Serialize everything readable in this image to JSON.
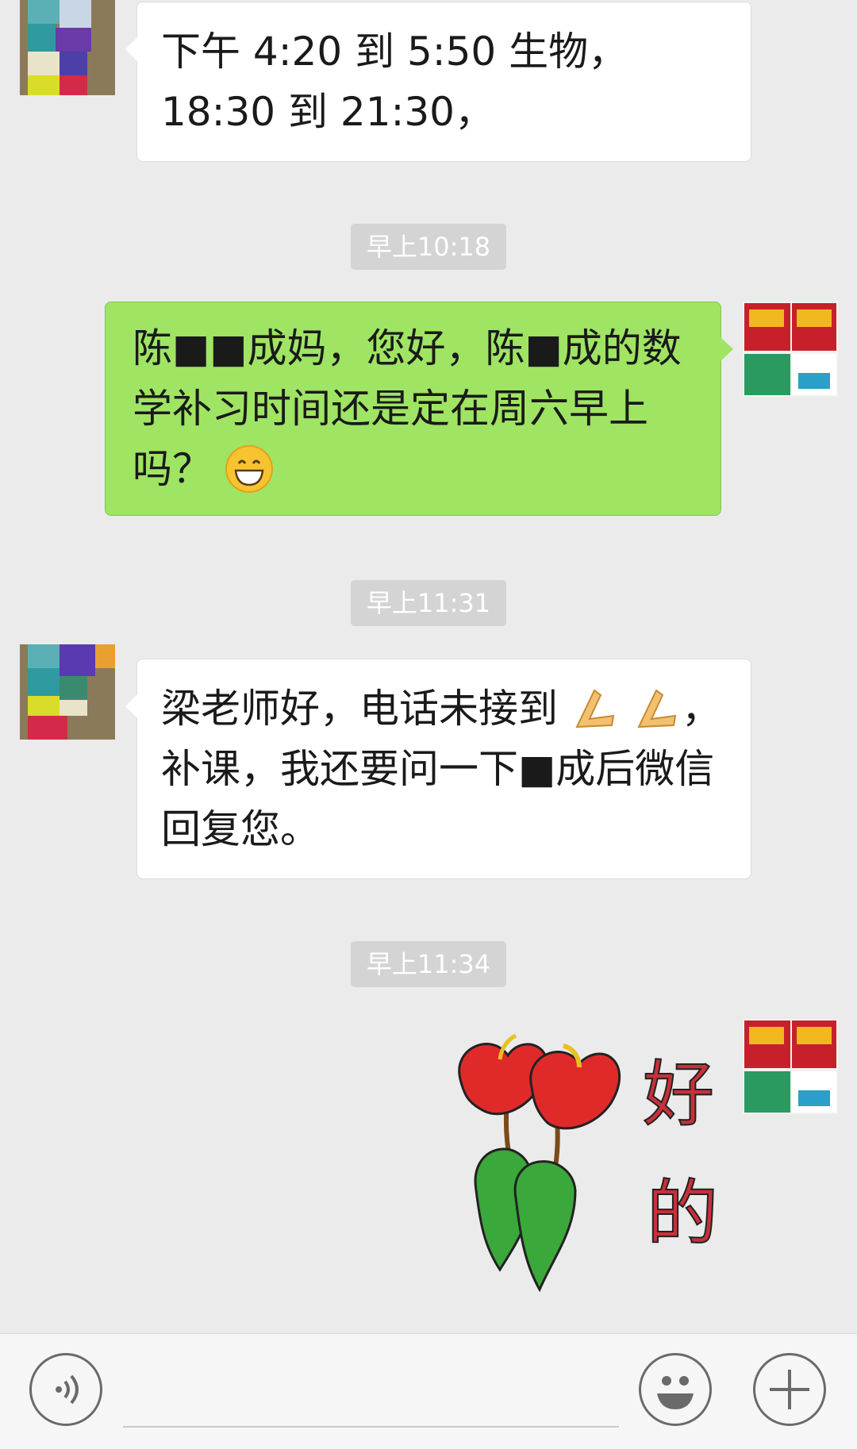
{
  "messages": [
    {
      "side": "left",
      "text": "下午 4:20 到 5:50 生物， 18:30 到 21:30，"
    },
    {
      "side": "right",
      "text": "陈■■成妈，您好，陈■成的数学补习时间还是定在周六早上吗？"
    },
    {
      "side": "left",
      "text": "梁老师好，电话未接到"
    },
    {
      "side": "left",
      "text": "，补课，我还要问一下■成后微信回复您。"
    }
  ],
  "timestamps": [
    "早上10:18",
    "早上11:31",
    "早上11:34"
  ],
  "sticker_text": [
    "好",
    "的"
  ],
  "icons": {
    "voice": "voice-icon",
    "emoji": "emoji-icon",
    "plus": "plus-icon",
    "smile": "grinning-emoji-icon",
    "hands": "pressed-hands-icon"
  },
  "colors": {
    "background": "#ebebeb",
    "sent_bubble": "#9fe463",
    "received_bubble": "#ffffff",
    "timestamp_bg": "#d4d4d4"
  }
}
